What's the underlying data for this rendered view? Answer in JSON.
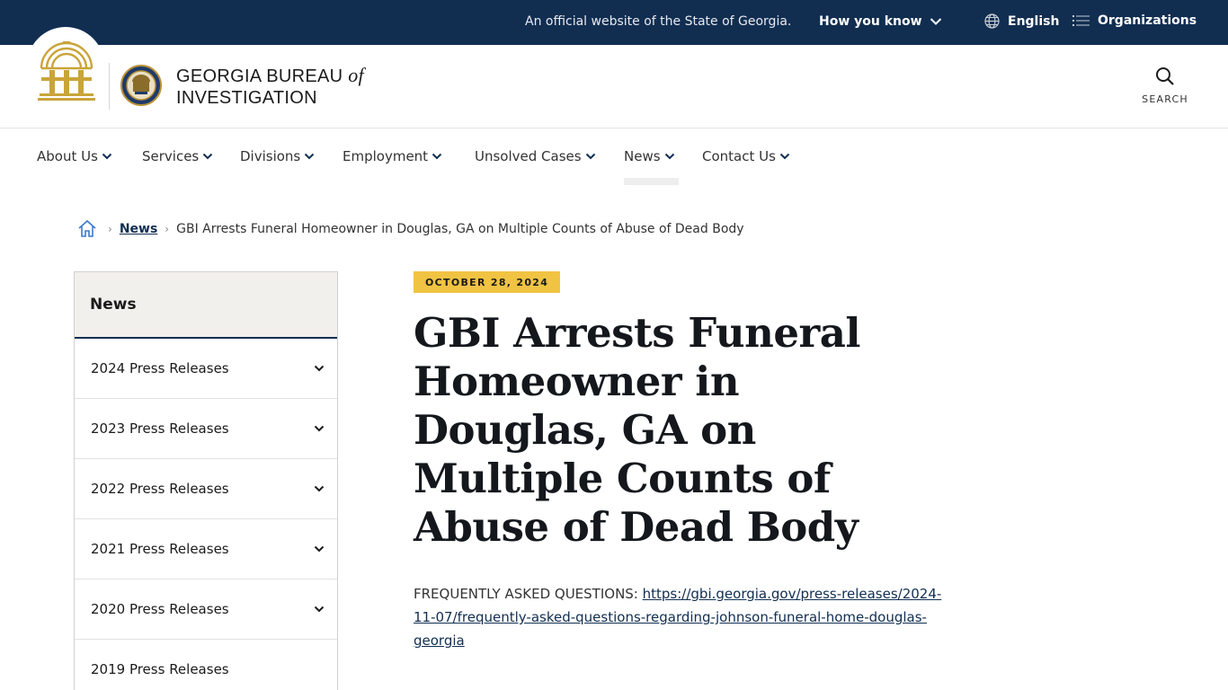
{
  "topbar": {
    "official_text": "An official website of the State of Georgia.",
    "how_you_know": "How you know",
    "language": "English",
    "organizations": "Organizations"
  },
  "header": {
    "site_name_line1": "GEORGIA BUREAU",
    "site_name_of": "of",
    "site_name_line2": "INVESTIGATION",
    "search_label": "SEARCH"
  },
  "nav": {
    "items": [
      {
        "label": "About Us"
      },
      {
        "label": "Services"
      },
      {
        "label": "Divisions"
      },
      {
        "label": "Employment"
      },
      {
        "label": "Unsolved Cases"
      },
      {
        "label": "News"
      },
      {
        "label": "Contact Us"
      }
    ],
    "active": "News"
  },
  "breadcrumb": {
    "news": "News",
    "current": "GBI Arrests Funeral Homeowner in Douglas, GA on Multiple Counts of Abuse of Dead Body"
  },
  "sidebar": {
    "title": "News",
    "items": [
      {
        "label": "2024 Press Releases"
      },
      {
        "label": "2023 Press Releases"
      },
      {
        "label": "2022 Press Releases"
      },
      {
        "label": "2021 Press Releases"
      },
      {
        "label": "2020 Press Releases"
      },
      {
        "label": "2019 Press Releases"
      }
    ]
  },
  "article": {
    "date": "OCTOBER 28, 2024",
    "title": "GBI Arrests Funeral Homeowner in Douglas, GA on Multiple Counts of Abuse of Dead Body",
    "faq_label": "FREQUENTLY ASKED QUESTIONS:",
    "faq_link": "https://gbi.georgia.gov/press-releases/2024-11-07/frequently-asked-questions-regarding-johnson-funeral-home-douglas-georgia"
  },
  "colors": {
    "topbar_bg": "#112e51",
    "badge_gold": "#f0c343",
    "seal_gold": "#c9a43a"
  }
}
